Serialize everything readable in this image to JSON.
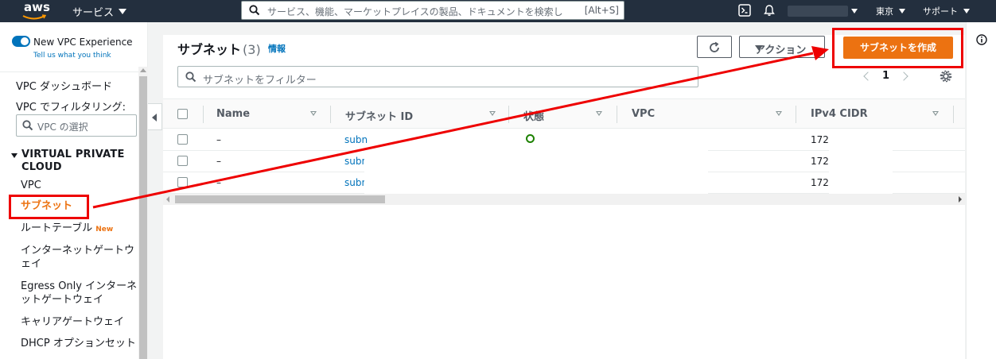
{
  "topnav": {
    "logo": "aws",
    "services_label": "サービス",
    "search_placeholder": "サービス、機能、マーケットプレイスの製品、ドキュメントを検索し",
    "search_shortcut": "[Alt+S]",
    "region": "東京",
    "support": "サポート"
  },
  "sidebar": {
    "new_vpc_label": "New VPC Experience",
    "tell_us": "Tell us what you think",
    "dashboard": "VPC ダッシュボード",
    "filter_label": "VPC でフィルタリング:",
    "vpc_select_placeholder": "VPC の選択",
    "section_title": "VIRTUAL PRIVATE CLOUD",
    "items": [
      {
        "label": "VPC"
      },
      {
        "label": "サブネット",
        "active": true
      },
      {
        "label": "ルートテーブル",
        "badge": "New"
      },
      {
        "label": "インターネットゲートウェイ"
      },
      {
        "label": "Egress Only インターネットゲートウェイ"
      },
      {
        "label": "キャリアゲートウェイ"
      },
      {
        "label": "DHCP オプションセット"
      }
    ]
  },
  "main": {
    "title": "サブネット",
    "count": "(3)",
    "info": "情報",
    "actions_label": "アクション",
    "create_label": "サブネットを作成",
    "filter_placeholder": "サブネットをフィルター",
    "page_number": "1",
    "table": {
      "headers": [
        "Name",
        "サブネット ID",
        "状態",
        "VPC",
        "IPv4 CIDR"
      ],
      "rows": [
        {
          "name": "–",
          "subnet_id": "subn",
          "cidr": "172"
        },
        {
          "name": "–",
          "subnet_id": "subn",
          "cidr": "172"
        },
        {
          "name": "–",
          "subnet_id": "subn",
          "cidr": "172"
        }
      ]
    }
  },
  "colors": {
    "nav_bg": "#232f3e",
    "accent_orange": "#ec7211",
    "link_blue": "#0073bb",
    "annotation_red": "#ee0000"
  }
}
